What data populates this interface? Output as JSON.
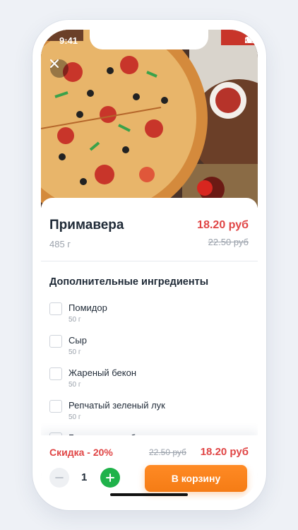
{
  "status": {
    "time": "9:41"
  },
  "product": {
    "title": "Примавера",
    "weight": "485 г",
    "price": "18.20 руб",
    "old_price": "22.50 руб"
  },
  "ingredients": {
    "title": "Дополнительные ингредиенты",
    "items": [
      {
        "name": "Помидор",
        "weight": "50 г"
      },
      {
        "name": "Сыр",
        "weight": "50 г"
      },
      {
        "name": "Жареный бекон",
        "weight": "50 г"
      },
      {
        "name": "Репчатый зеленый лук",
        "weight": "50 г"
      },
      {
        "name": "Баварские колбаски",
        "weight": ""
      }
    ]
  },
  "summary": {
    "discount": "Скидка - 20%",
    "old_price": "22.50 руб",
    "price": "18.20 руб",
    "quantity": "1",
    "cart_button": "В корзину"
  },
  "icons": {
    "close": "close-icon",
    "minus": "minus-icon",
    "plus": "plus-icon",
    "signal": "signal-icon",
    "wifi": "wifi-icon",
    "battery": "battery-icon"
  },
  "colors": {
    "price_red": "#e04545",
    "accent_orange": "#f57c15",
    "plus_green": "#1fb24a"
  }
}
